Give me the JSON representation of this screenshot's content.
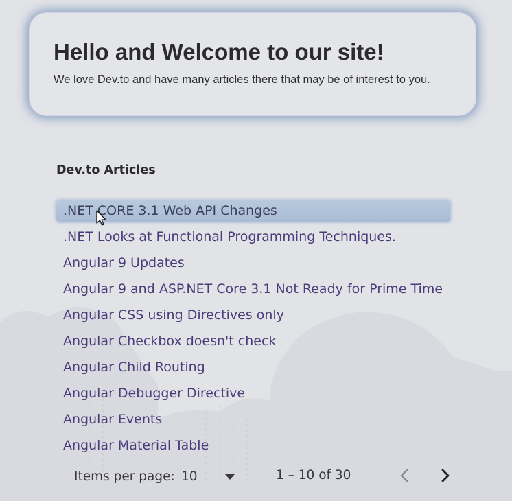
{
  "hero": {
    "title": "Hello and Welcome to our site!",
    "subtitle": "We love Dev.to and have many articles there that may be of interest to you."
  },
  "articles": {
    "heading": "Dev.to Articles",
    "items": [
      {
        "label": ".NET CORE 3.1 Web API Changes",
        "active": true
      },
      {
        "label": ".NET Looks at Functional Programming Techniques.",
        "active": false
      },
      {
        "label": "Angular 9 Updates",
        "active": false
      },
      {
        "label": "Angular 9 and ASP.NET Core 3.1 Not Ready for Prime Time",
        "active": false
      },
      {
        "label": "Angular CSS using Directives only",
        "active": false
      },
      {
        "label": "Angular Checkbox doesn't check",
        "active": false
      },
      {
        "label": "Angular Child Routing",
        "active": false
      },
      {
        "label": "Angular Debugger Directive",
        "active": false
      },
      {
        "label": "Angular Events",
        "active": false
      },
      {
        "label": "Angular Material Table",
        "active": false
      }
    ]
  },
  "paginator": {
    "items_per_page_label": "Items per page:",
    "page_size": "10",
    "range_label": "1 – 10 of 30",
    "prev_icon": "chevron-left-icon",
    "next_icon": "chevron-right-icon"
  },
  "colors": {
    "background": "#e2e3e7",
    "link": "#4a3c7a",
    "active_highlight": "#b0c2d9",
    "hero_glow": "#466eaa"
  }
}
